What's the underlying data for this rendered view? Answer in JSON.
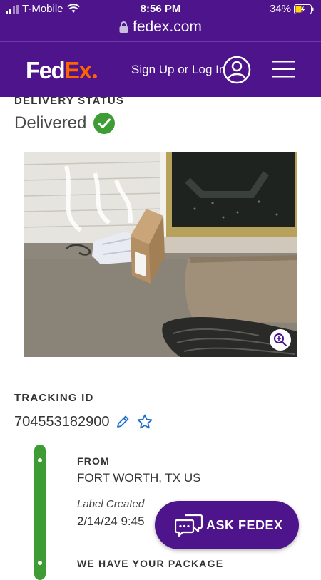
{
  "status_bar": {
    "carrier": "T-Mobile",
    "time": "8:56 PM",
    "battery": "34%"
  },
  "browser": {
    "url": "fedex.com"
  },
  "header": {
    "logo_fed": "Fed",
    "logo_ex": "Ex",
    "signin_label": "Sign Up or Log In"
  },
  "delivery": {
    "section_label": "DELIVERY STATUS",
    "status": "Delivered"
  },
  "tracking": {
    "section_label": "TRACKING ID",
    "id": "704553182900"
  },
  "timeline": {
    "from_label": "FROM",
    "from_value": "FORT WORTH, TX US",
    "event_label": "Label Created",
    "event_date": "2/14/24 9:45",
    "next_label": "WE HAVE YOUR PACKAGE"
  },
  "ask_button": {
    "label": "ASK FEDEX"
  },
  "colors": {
    "brand_purple": "#4d148c",
    "brand_orange": "#ff6200",
    "success_green": "#3e9c35"
  }
}
